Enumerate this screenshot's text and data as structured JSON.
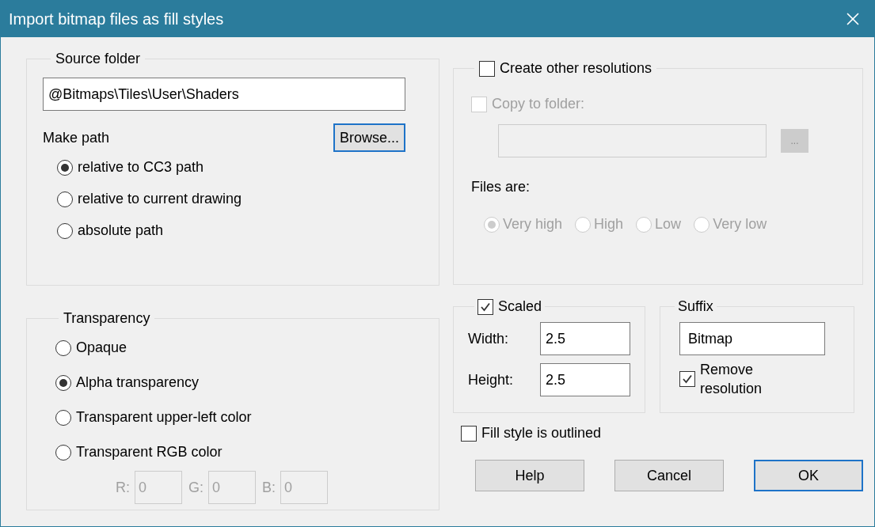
{
  "window": {
    "title": "Import bitmap files as fill styles"
  },
  "source_folder": {
    "title": "Source folder",
    "path": "@Bitmaps\\Tiles\\User\\Shaders",
    "make_path_label": "Make path",
    "browse_button": "Browse...",
    "options": [
      {
        "label": "relative to CC3 path",
        "selected": true
      },
      {
        "label": "relative to current drawing",
        "selected": false
      },
      {
        "label": "absolute path",
        "selected": false
      }
    ]
  },
  "transparency": {
    "title": "Transparency",
    "options": [
      {
        "label": "Opaque",
        "selected": false
      },
      {
        "label": "Alpha transparency",
        "selected": true
      },
      {
        "label": "Transparent upper-left color",
        "selected": false
      },
      {
        "label": "Transparent RGB color",
        "selected": false
      }
    ],
    "rgb_disabled": true,
    "rgb_fields": [
      {
        "label": "R:",
        "value": "0"
      },
      {
        "label": "G:",
        "value": "0"
      },
      {
        "label": "B:",
        "value": "0"
      }
    ]
  },
  "other_resolutions": {
    "label": "Create other resolutions",
    "checked": false,
    "disabled": true,
    "copy_to_folder": {
      "label": "Copy to folder:",
      "checked": false
    },
    "browse_button": "...",
    "files_are_label": "Files are:",
    "levels": [
      {
        "label": "Very high",
        "selected": true
      },
      {
        "label": "High",
        "selected": false
      },
      {
        "label": "Low",
        "selected": false
      },
      {
        "label": "Very low",
        "selected": false
      }
    ]
  },
  "scaled": {
    "label": "Scaled",
    "checked": true,
    "fields": [
      {
        "label": "Width:",
        "value": "2.5"
      },
      {
        "label": "Height:",
        "value": "2.5"
      }
    ]
  },
  "suffix": {
    "title": "Suffix",
    "value": "Bitmap",
    "remove_resolution": {
      "label": "Remove resolution",
      "checked": true
    }
  },
  "fill_outlined": {
    "label": "Fill style is outlined",
    "checked": false
  },
  "buttons": [
    {
      "label": "Help",
      "default": false
    },
    {
      "label": "Cancel",
      "default": false
    },
    {
      "label": "OK",
      "default": true
    }
  ]
}
